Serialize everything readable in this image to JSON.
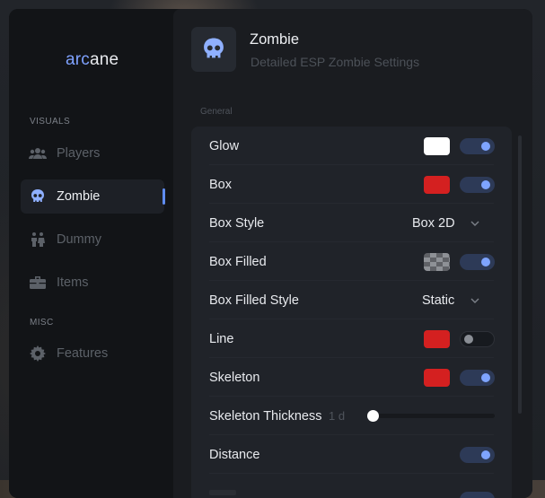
{
  "brand": {
    "part1": "arc",
    "part2": "ane",
    "accent_color": "#7fa2ff"
  },
  "sidebar": {
    "sections": [
      {
        "label": "VISUALS"
      },
      {
        "label": "MISC"
      }
    ],
    "items": [
      {
        "label": "Players",
        "icon": "users-icon",
        "active": false
      },
      {
        "label": "Zombie",
        "icon": "skull-icon",
        "active": true
      },
      {
        "label": "Dummy",
        "icon": "dummy-icon",
        "active": false
      },
      {
        "label": "Items",
        "icon": "briefcase-icon",
        "active": false
      },
      {
        "label": "Features",
        "icon": "gear-icon",
        "active": false
      }
    ]
  },
  "header": {
    "title": "Zombie",
    "subtitle": "Detailed ESP Zombie Settings",
    "icon": "skull-icon"
  },
  "group": {
    "label": "General"
  },
  "settings": [
    {
      "label": "Glow",
      "color": "#ffffff",
      "enabled": true
    },
    {
      "label": "Box",
      "color": "#d42020",
      "enabled": true
    },
    {
      "label": "Box Style",
      "value": "Box 2D"
    },
    {
      "label": "Box Filled",
      "color": "checkerboard",
      "enabled": true
    },
    {
      "label": "Box Filled Style",
      "value": "Static"
    },
    {
      "label": "Line",
      "color": "#d42020",
      "enabled": false
    },
    {
      "label": "Skeleton",
      "color": "#d42020",
      "enabled": true
    },
    {
      "label": "Skeleton Thickness",
      "value_text": "1 d",
      "value": 0
    },
    {
      "label": "Distance",
      "enabled": true
    }
  ],
  "colors": {
    "accent": "#7ea4ff",
    "toggle_on_bg": "#2d3a57",
    "red": "#d42020"
  }
}
